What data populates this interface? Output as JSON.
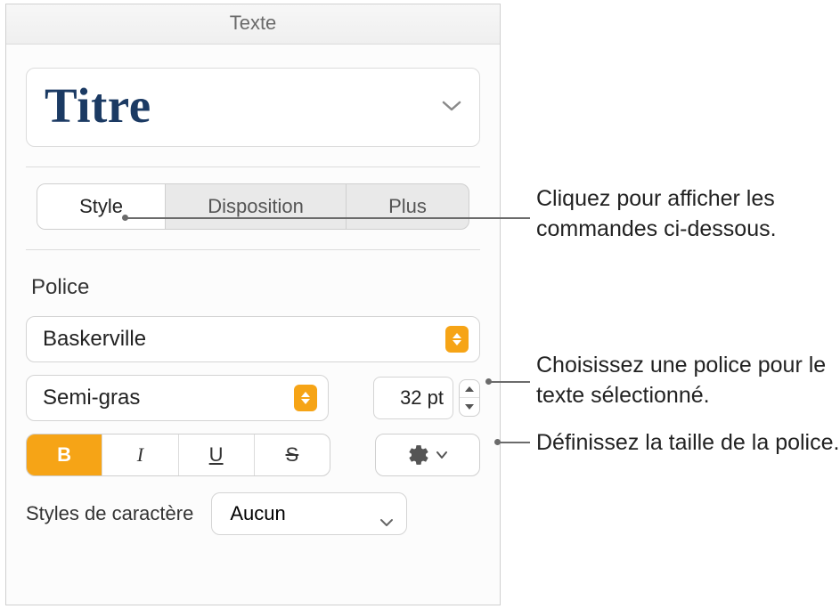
{
  "header": {
    "title": "Texte"
  },
  "paragraph_style": {
    "name": "Titre"
  },
  "tabs": {
    "style": "Style",
    "disposition": "Disposition",
    "plus": "Plus"
  },
  "font_section": {
    "label": "Police",
    "family": "Baskerville",
    "weight": "Semi-gras",
    "size": "32 pt",
    "bold": "B",
    "italic": "I",
    "underline": "U",
    "strike": "S"
  },
  "char_styles": {
    "label": "Styles de caractère",
    "value": "Aucun"
  },
  "callouts": {
    "tabs": "Cliquez pour afficher les commandes ci-dessous.",
    "font": "Choisissez une police pour le texte sélectionné.",
    "size": "Définissez la taille de la police."
  }
}
